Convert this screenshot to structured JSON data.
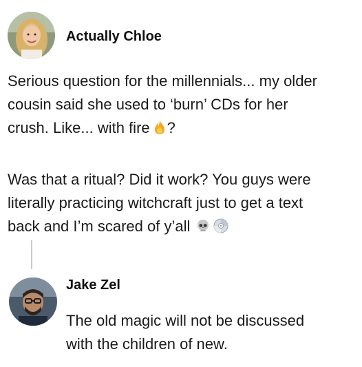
{
  "post": {
    "author": "Actually Chloe",
    "paragraph1": {
      "line1": "Serious question for the millennials... my older",
      "line2": "cousin said she used to ‘burn’ CDs for her",
      "line3_before_emoji": "crush. Like... with fire",
      "line3_after_emoji": "?",
      "emoji": "fire-icon"
    },
    "paragraph2": {
      "line1": "Was that a ritual? Did it work? You guys were",
      "line2": "literally practicing witchcraft just to get a text",
      "line3": "back and I’m scared of y’all",
      "emojis": [
        "skull-icon",
        "cd-disc-icon"
      ]
    }
  },
  "reply": {
    "author": "Jake Zel",
    "line1": "The old magic will not be discussed",
    "line2": "with the children of new."
  },
  "colors": {
    "text": "#1a1a1a",
    "thread_line": "#c9c9c9",
    "background": "#ffffff"
  }
}
